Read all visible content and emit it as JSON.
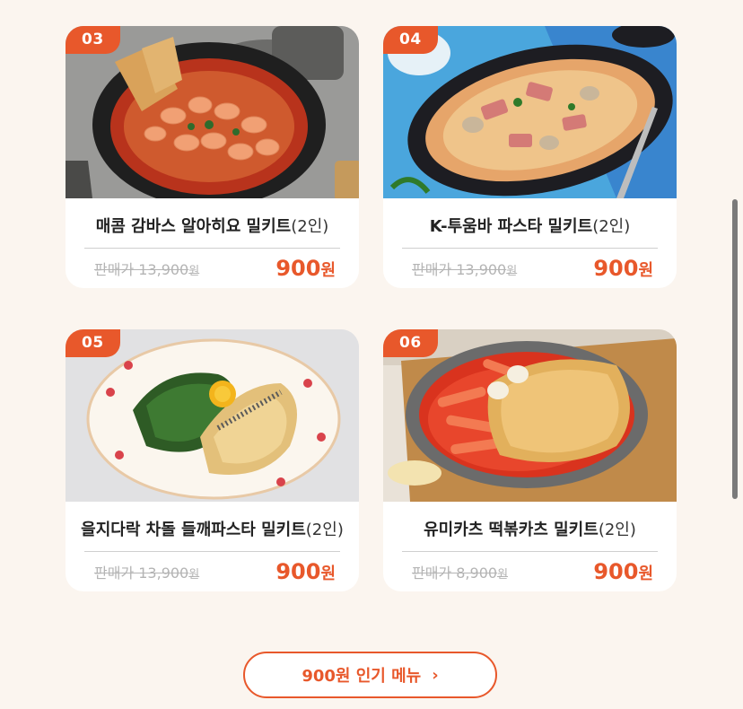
{
  "products": [
    {
      "badge": "03",
      "title": "매콤 감바스 알아히요 밀키트",
      "title_suffix": "(2인)",
      "original_label": "판매가 13,900",
      "original_unit": "원",
      "sale_amount": "900",
      "sale_unit": "원",
      "image_icon": "gambas-dish-photo"
    },
    {
      "badge": "04",
      "title": "K-투움바 파스타 밀키트",
      "title_suffix": "(2인)",
      "original_label": "판매가 13,900",
      "original_unit": "원",
      "sale_amount": "900",
      "sale_unit": "원",
      "image_icon": "toowoomba-pasta-photo"
    },
    {
      "badge": "05",
      "title": "을지다락 차돌 들깨파스타 밀키트",
      "title_suffix": "(2인)",
      "original_label": "판매가 13,900",
      "original_unit": "원",
      "sale_amount": "900",
      "sale_unit": "원",
      "image_icon": "perilla-pasta-photo"
    },
    {
      "badge": "06",
      "title": "유미카츠 떡볶카츠 밀키트",
      "title_suffix": "(2인)",
      "original_label": "판매가 8,900",
      "original_unit": "원",
      "sale_amount": "900",
      "sale_unit": "원",
      "image_icon": "tteokbokki-katsu-photo"
    }
  ],
  "more_button": {
    "label": "900원 인기 메뉴",
    "chevron": "›"
  },
  "colors": {
    "accent": "#e8582b",
    "background": "#fbf5ef"
  }
}
